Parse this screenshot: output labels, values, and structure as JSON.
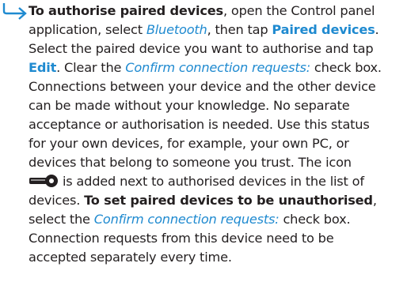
{
  "icons": {
    "bullet": "arrow-right-icon",
    "key": "key-icon",
    "accent": "#1f8ad0"
  },
  "content": {
    "l1": {
      "bold": "To authorise paired devices",
      "text": ", open the Control panel"
    },
    "l2": {
      "a": "application, select ",
      "link1": "Bluetooth",
      "b": ", then tap ",
      "link2": "Paired devices",
      "c": "."
    },
    "l3": "Select the paired device you want to authorise and tap",
    "l4": {
      "link": "Edit",
      "a": ". Clear the ",
      "link2": "Confirm connection requests:",
      "b": " check box."
    },
    "l5": "Connections between your device and the other device",
    "l6": "can be made without your knowledge. No separate",
    "l7": "acceptance or authorisation is needed. Use this status",
    "l8": "for your own devices, for example, your own PC, or",
    "l9": "devices that belong to someone you trust. The icon",
    "l10": "is added next to authorised devices in the list of",
    "l11": {
      "a": "devices. ",
      "bold": "To set paired devices to be unauthorised",
      "b": ","
    },
    "l12": {
      "a": "select the ",
      "link": "Confirm connection requests:",
      "b": " check box."
    },
    "l13": "Connection requests from this device need to be",
    "l14": "accepted separately every time."
  }
}
